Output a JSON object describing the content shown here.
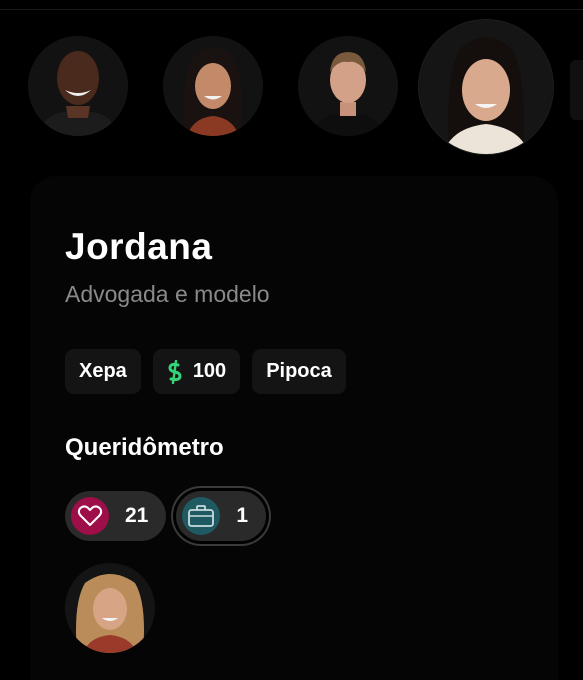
{
  "carousel": {
    "avatars": [
      {
        "icon": "person-avatar-icon",
        "selected": false
      },
      {
        "icon": "person-avatar-icon",
        "selected": false
      },
      {
        "icon": "person-avatar-icon",
        "selected": false
      },
      {
        "icon": "person-avatar-icon",
        "selected": true
      }
    ]
  },
  "profile": {
    "name": "Jordana",
    "description": "Advogada e modelo"
  },
  "chips": {
    "group": "Xepa",
    "money_icon": "₿",
    "money": "100",
    "origin": "Pipoca"
  },
  "queridometro": {
    "title": "Queridômetro",
    "reactions": [
      {
        "icon": "heart-icon",
        "count": "21",
        "color": "#9e0e48"
      },
      {
        "icon": "suitcase-icon",
        "count": "1",
        "color": "#1f5a63"
      }
    ]
  },
  "colors": {
    "background": "#000000",
    "card": "#050505",
    "chip": "#141414",
    "money_accent": "#34d37a",
    "subtitle": "#8a8a8a"
  }
}
